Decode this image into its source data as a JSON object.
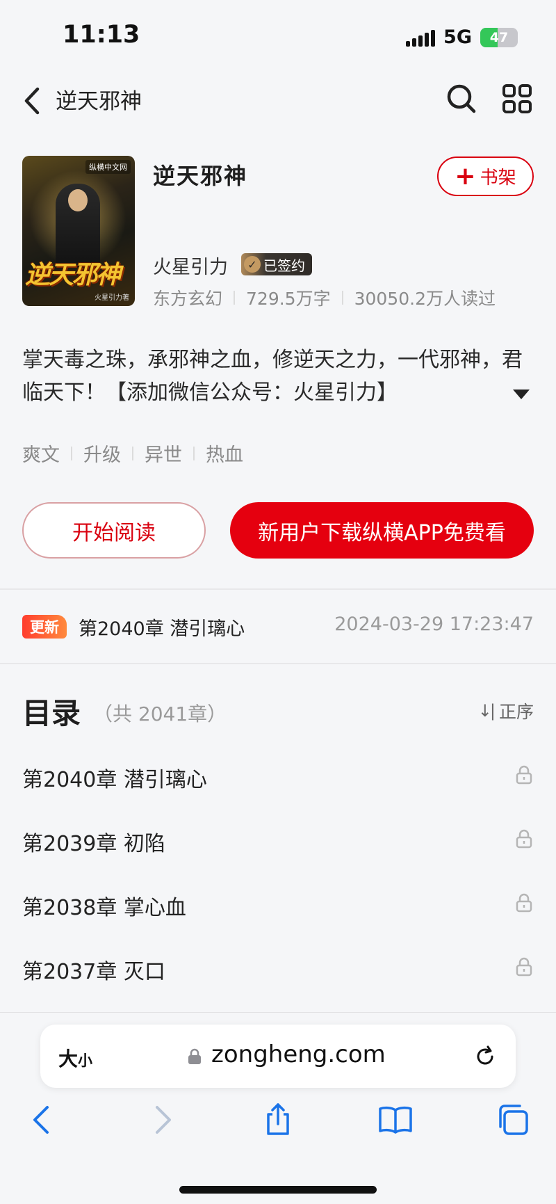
{
  "status_bar": {
    "time": "11:13",
    "network": "5G",
    "battery": "47"
  },
  "header": {
    "title": "逆天邪神"
  },
  "book": {
    "cover_logo": "纵横中文网",
    "cover_title": "逆天邪神",
    "cover_author": "火星引力著",
    "title": "逆天邪神",
    "shelf_label": "书架",
    "author": "火星引力",
    "signed_label": "已签约",
    "category": "东方玄幻",
    "word_count": "729.5万字",
    "readers": "30050.2万人读过",
    "intro": "掌天毒之珠，承邪神之血，修逆天之力，一代邪神，君临天下！【添加微信公众号：火星引力】",
    "tags": [
      "爽文",
      "升级",
      "异世",
      "热血"
    ]
  },
  "actions": {
    "read_label": "开始阅读",
    "download_label": "新用户下载纵横APP免费看"
  },
  "update": {
    "badge": "更新",
    "chapter": "第2040章 潜引璃心",
    "time": "2024-03-29 17:23:47"
  },
  "toc": {
    "title": "目录",
    "count": "（共 2041章）",
    "sort_label": "正序",
    "chapters": [
      {
        "label": "第2040章 潜引璃心"
      },
      {
        "label": "第2039章 初陷"
      },
      {
        "label": "第2038章 掌心血"
      },
      {
        "label": "第2037章 灭口"
      }
    ]
  },
  "browser": {
    "text_size_big": "大",
    "text_size_small": "小",
    "url": "zongheng.com"
  },
  "colors": {
    "accent": "#e5000f",
    "background": "#f5f6f8",
    "muted": "#8a8a8a"
  }
}
